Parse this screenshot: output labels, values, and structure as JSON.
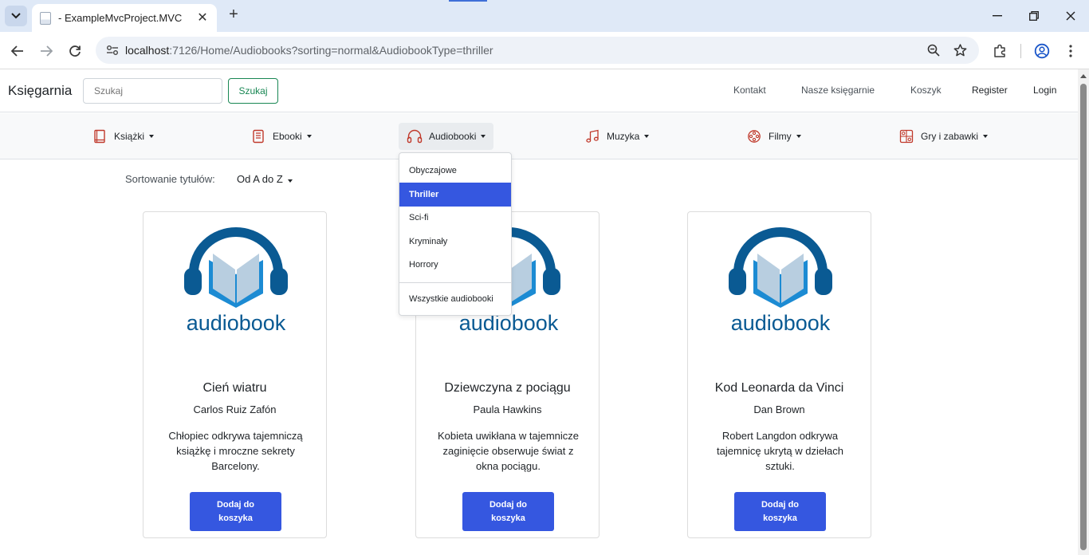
{
  "browser": {
    "tab_title": "- ExampleMvcProject.MVC",
    "url_host": "localhost",
    "url_rest": ":7126/Home/Audiobooks?sorting=normal&AudiobookType=thriller"
  },
  "header": {
    "brand": "Księgarnia",
    "search_placeholder": "Szukaj",
    "search_button": "Szukaj",
    "links": [
      "Kontakt",
      "Nasze księgarnie",
      "Koszyk",
      "Register",
      "Login"
    ]
  },
  "categories": [
    {
      "label": "Książki",
      "icon": "book-icon"
    },
    {
      "label": "Ebooki",
      "icon": "ebook-icon"
    },
    {
      "label": "Audiobooki",
      "icon": "headphones-icon"
    },
    {
      "label": "Muzyka",
      "icon": "music-icon"
    },
    {
      "label": "Filmy",
      "icon": "film-reel-icon"
    },
    {
      "label": "Gry i zabawki",
      "icon": "toys-icon"
    }
  ],
  "dropdown": {
    "items": [
      "Obyczajowe",
      "Thriller",
      "Sci-fi",
      "Kryminały",
      "Horrory"
    ],
    "active": "Thriller",
    "all_label": "Wszystkie audiobooki"
  },
  "sorting": {
    "label": "Sortowanie tytułów:",
    "value": "Od A do Z"
  },
  "cover_caption": "audiobook",
  "colors": {
    "accent": "#3557e0",
    "search_green": "#198754",
    "logo_blue": "#0a5a93",
    "icon_red": "#c0392b"
  },
  "books": [
    {
      "title": "Cień wiatru",
      "author": "Carlos Ruiz Zafón",
      "description": "Chłopiec odkrywa tajemniczą książkę i mroczne sekrety Barcelony.",
      "button": "Dodaj do koszyka"
    },
    {
      "title": "Dziewczyna z pociągu",
      "author": "Paula Hawkins",
      "description": "Kobieta uwikłana w tajemnicze zaginięcie obserwuje świat z okna pociągu.",
      "button": "Dodaj do koszyka"
    },
    {
      "title": "Kod Leonarda da Vinci",
      "author": "Dan Brown",
      "description": "Robert Langdon odkrywa tajemnicę ukrytą w dziełach sztuki.",
      "button": "Dodaj do koszyka"
    }
  ]
}
